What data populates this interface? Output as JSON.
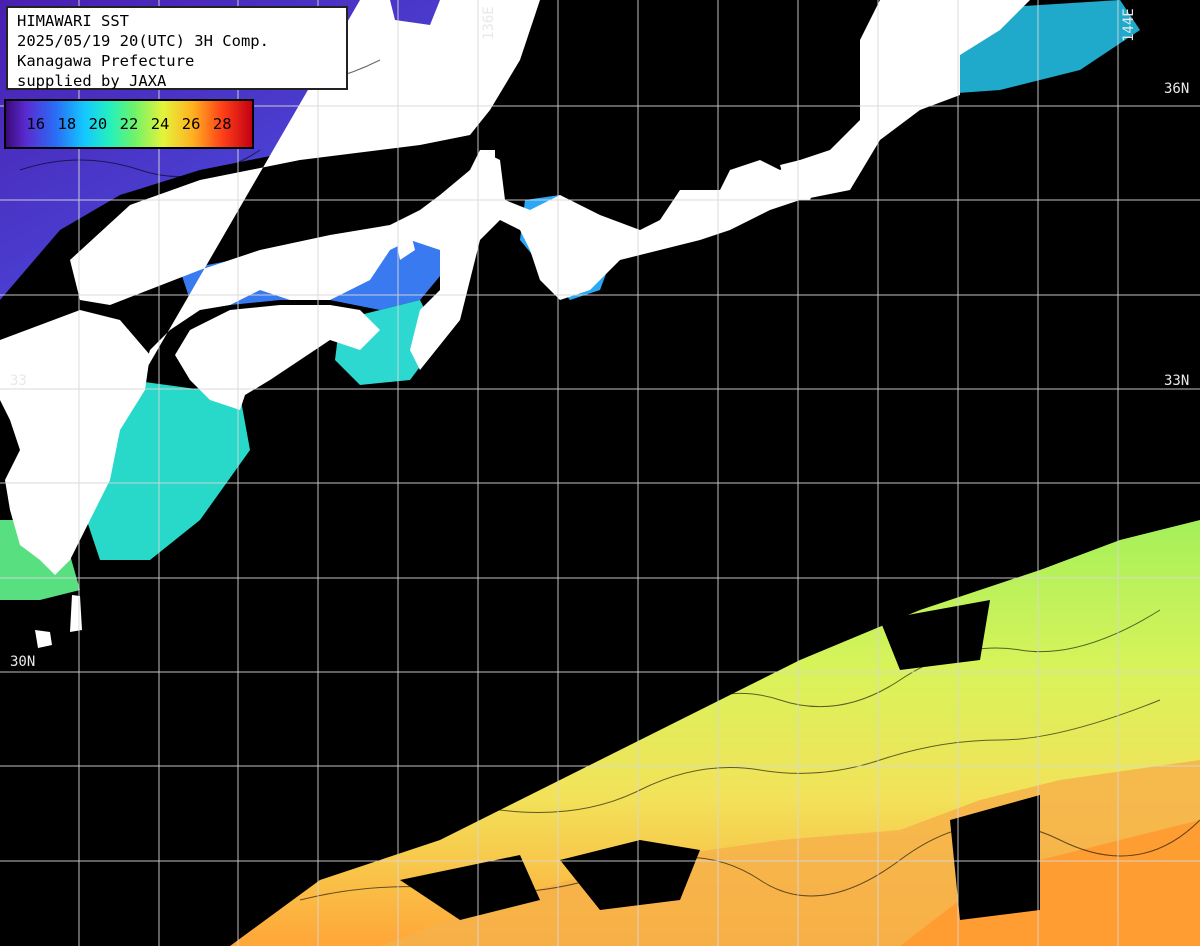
{
  "header": {
    "line1": "HIMAWARI SST",
    "line2": "2025/05/19 20(UTC) 3H Comp.",
    "line3": "Kanagawa Prefecture",
    "line4": "supplied by JAXA"
  },
  "legend": {
    "ticks": [
      "16",
      "18",
      "20",
      "22",
      "24",
      "26",
      "28"
    ]
  },
  "grid_labels": {
    "lat_36": "36N",
    "lat_33": "33N",
    "lat_33_left": "33",
    "lat_30": "30N",
    "lon_136": "136E",
    "lon_144": "144E"
  },
  "colors": {
    "land": "#ffffff",
    "no_data": "#000000",
    "grid": "#d8d8d8",
    "sst_16": "#5a2ad0",
    "sst_20": "#14c8ff",
    "sst_22": "#6cf36a",
    "sst_24": "#e5f33a",
    "sst_26": "#ff8a20",
    "sst_28": "#c40014"
  }
}
